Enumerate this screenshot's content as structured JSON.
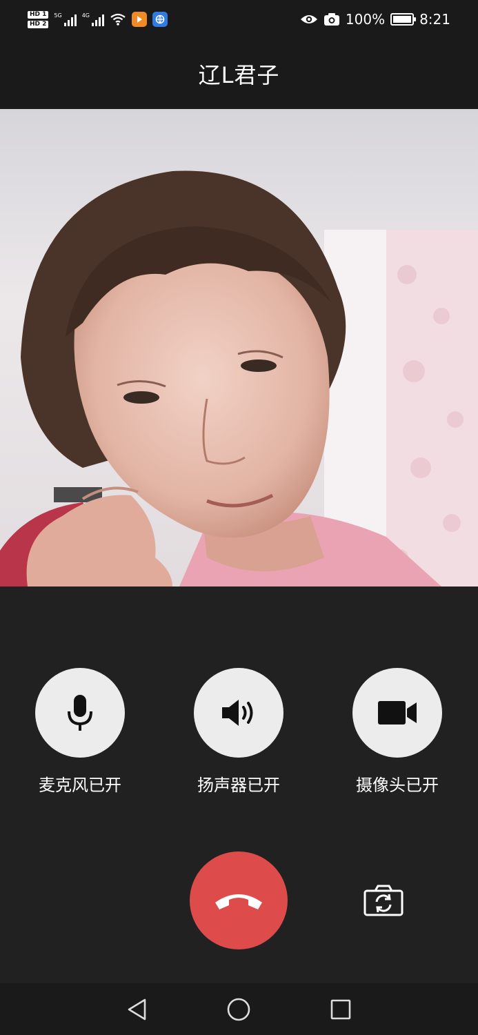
{
  "status_bar": {
    "sim1": "HD 1",
    "sim2": "HD 2",
    "net1": "5G",
    "net2": "4G",
    "battery_percent": "100%",
    "time": "8:21",
    "icons": [
      "eye-icon",
      "camera-icon",
      "battery-icon"
    ]
  },
  "call": {
    "caller_name": "辽L君子"
  },
  "controls": {
    "mic": {
      "label": "麦克风已开",
      "icon": "microphone-icon"
    },
    "speaker": {
      "label": "扬声器已开",
      "icon": "speaker-icon"
    },
    "camera": {
      "label": "摄像头已开",
      "icon": "video-camera-icon"
    }
  },
  "actions": {
    "hangup_icon": "hangup-icon",
    "switch_camera_icon": "switch-camera-icon"
  },
  "colors": {
    "background": "#212121",
    "hangup": "#dd4b4b",
    "control_button": "#ececec"
  }
}
